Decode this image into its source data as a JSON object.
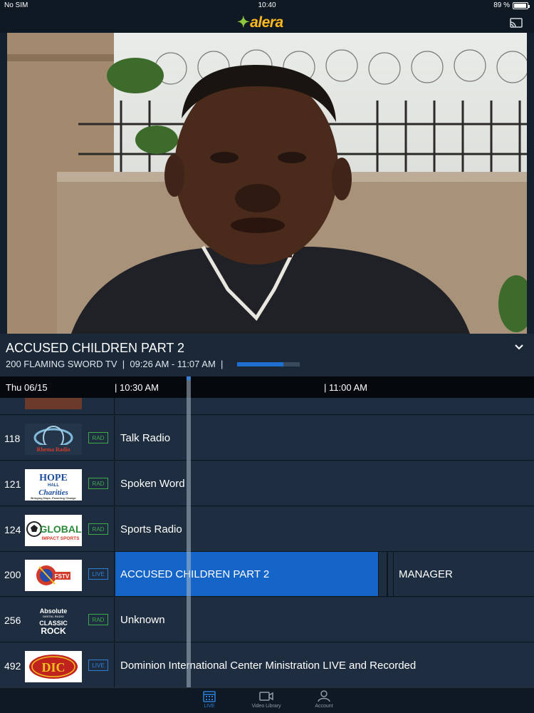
{
  "status": {
    "carrier": "No SIM",
    "time": "10:40",
    "battery": "89 %"
  },
  "header": {
    "logo_text": "alera",
    "cast_icon": "cast-icon"
  },
  "now_playing": {
    "title": "ACCUSED CHILDREN PART 2",
    "channel": "200 FLAMING SWORD TV",
    "time_range": "09:26 AM - 11:07 AM",
    "progress": 0.74
  },
  "timebar": {
    "date": "Thu 06/15",
    "t1": "| 10:30 AM",
    "t2": "| 11:00 AM"
  },
  "channels": [
    {
      "number": "118",
      "logo": "Rhema Radio",
      "tag": "RAD",
      "program": "Talk Radio"
    },
    {
      "number": "121",
      "logo": "HOPE HALL Charities",
      "tag": "RAD",
      "program": "Spoken Word"
    },
    {
      "number": "124",
      "logo": "GLOBAL IMPACT SPORTS",
      "tag": "RAD",
      "program": "Sports Radio"
    },
    {
      "number": "200",
      "logo": "FSTV",
      "tag": "LIVE",
      "program": "ACCUSED CHILDREN PART 2",
      "next_program": "MANAGER"
    },
    {
      "number": "256",
      "logo": "Absolute Classic Rock",
      "tag": "RAD",
      "program": "Unknown"
    },
    {
      "number": "492",
      "logo": "DIC",
      "tag": "LIVE",
      "program": "Dominion International Center Ministration LIVE and Recorded"
    }
  ],
  "tabs": [
    {
      "label": "LIVE",
      "icon": "calendar-icon"
    },
    {
      "label": "Video Library",
      "icon": "video-camera-icon"
    },
    {
      "label": "Account",
      "icon": "person-icon"
    }
  ],
  "colors": {
    "accent": "#1565c8",
    "rad": "#3fa84a",
    "live": "#2d7fd8",
    "logo": "#ffb91e"
  }
}
